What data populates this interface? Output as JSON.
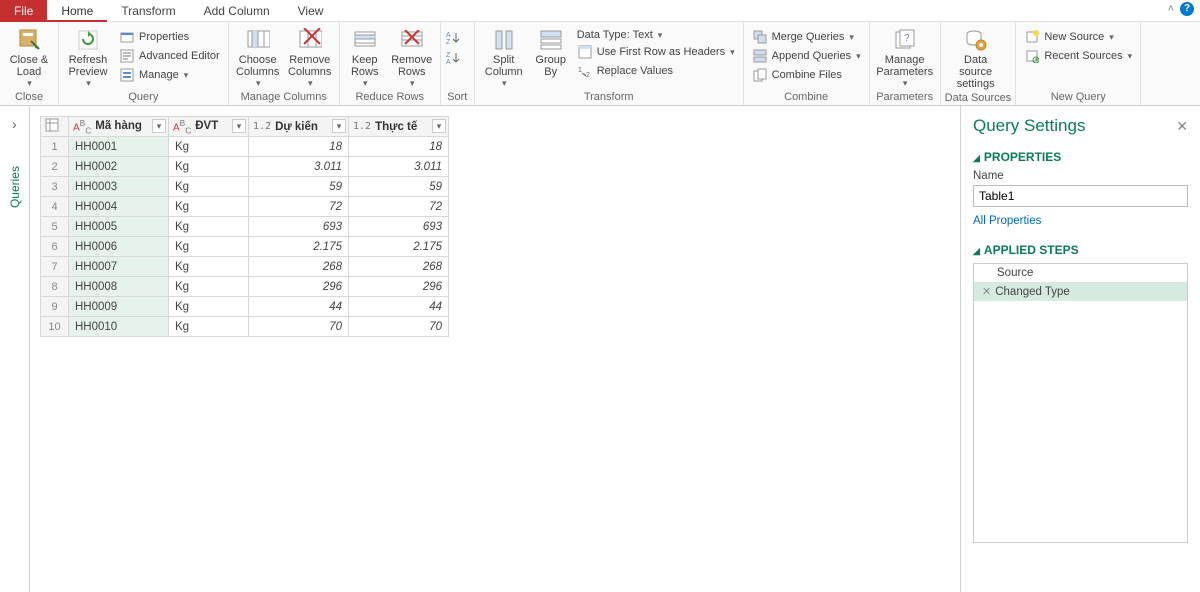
{
  "tabs": {
    "file": "File",
    "home": "Home",
    "transform": "Transform",
    "addcolumn": "Add Column",
    "view": "View"
  },
  "ribbon": {
    "close": {
      "closeLoad": "Close &\nLoad",
      "group": "Close"
    },
    "query": {
      "refreshPreview": "Refresh\nPreview",
      "properties": "Properties",
      "advancedEditor": "Advanced Editor",
      "manage": "Manage",
      "group": "Query"
    },
    "manageColumns": {
      "chooseColumns": "Choose\nColumns",
      "removeColumns": "Remove\nColumns",
      "group": "Manage Columns"
    },
    "reduceRows": {
      "keepRows": "Keep\nRows",
      "removeRows": "Remove\nRows",
      "group": "Reduce Rows"
    },
    "sort": {
      "group": "Sort"
    },
    "transform": {
      "splitColumn": "Split\nColumn",
      "groupBy": "Group\nBy",
      "dataType": "Data Type: Text",
      "useFirstRow": "Use First Row as Headers",
      "replaceValues": "Replace Values",
      "group": "Transform"
    },
    "combine": {
      "mergeQueries": "Merge Queries",
      "appendQueries": "Append Queries",
      "combineFiles": "Combine Files",
      "group": "Combine"
    },
    "parameters": {
      "manageParameters": "Manage\nParameters",
      "group": "Parameters"
    },
    "dataSources": {
      "dataSourceSettings": "Data source\nsettings",
      "group": "Data Sources"
    },
    "newQuery": {
      "newSource": "New Source",
      "recentSources": "Recent Sources",
      "group": "New Query"
    }
  },
  "sidebar": {
    "label": "Queries"
  },
  "table": {
    "columns": [
      {
        "name": "Mã hàng",
        "typeTag": "ABC",
        "typePrefix": "A"
      },
      {
        "name": "ĐVT",
        "typeTag": "ABC",
        "typePrefix": "A"
      },
      {
        "name": "Dự kiến",
        "typeTag": "1.2"
      },
      {
        "name": "Thực tế",
        "typeTag": "1.2"
      }
    ],
    "rows": [
      {
        "c1": "HH0001",
        "c2": "Kg",
        "c3": "18",
        "c4": "18"
      },
      {
        "c1": "HH0002",
        "c2": "Kg",
        "c3": "3.011",
        "c4": "3.011"
      },
      {
        "c1": "HH0003",
        "c2": "Kg",
        "c3": "59",
        "c4": "59"
      },
      {
        "c1": "HH0004",
        "c2": "Kg",
        "c3": "72",
        "c4": "72"
      },
      {
        "c1": "HH0005",
        "c2": "Kg",
        "c3": "693",
        "c4": "693"
      },
      {
        "c1": "HH0006",
        "c2": "Kg",
        "c3": "2.175",
        "c4": "2.175"
      },
      {
        "c1": "HH0007",
        "c2": "Kg",
        "c3": "268",
        "c4": "268"
      },
      {
        "c1": "HH0008",
        "c2": "Kg",
        "c3": "296",
        "c4": "296"
      },
      {
        "c1": "HH0009",
        "c2": "Kg",
        "c3": "44",
        "c4": "44"
      },
      {
        "c1": "HH0010",
        "c2": "Kg",
        "c3": "70",
        "c4": "70"
      }
    ]
  },
  "querySettings": {
    "title": "Query Settings",
    "propertiesSection": "PROPERTIES",
    "nameLabel": "Name",
    "nameValue": "Table1",
    "allProperties": "All Properties",
    "appliedStepsSection": "APPLIED STEPS",
    "steps": [
      {
        "label": "Source",
        "selected": false
      },
      {
        "label": "Changed Type",
        "selected": true
      }
    ]
  }
}
